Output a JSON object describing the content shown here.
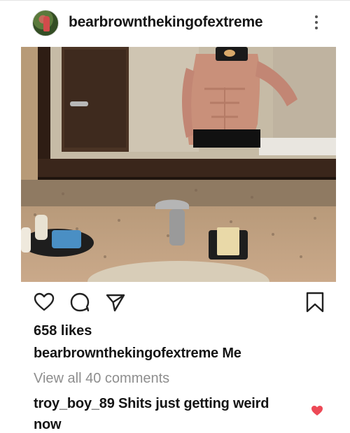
{
  "post": {
    "username": "bearbrownthekingofextreme",
    "likes": "658 likes",
    "caption_user": "bearbrownthekingofextreme",
    "caption_text": "Me",
    "view_all": "View all 40 comments"
  },
  "comment": {
    "user": "troy_boy_89",
    "text": "Shits just getting weird now"
  },
  "colors": {
    "like_heart": "#ed4956",
    "muted_text": "#8e8e8e"
  },
  "icons": [
    "heart-icon",
    "comment-icon",
    "share-icon",
    "bookmark-icon",
    "more-options-icon",
    "small-heart-icon"
  ]
}
